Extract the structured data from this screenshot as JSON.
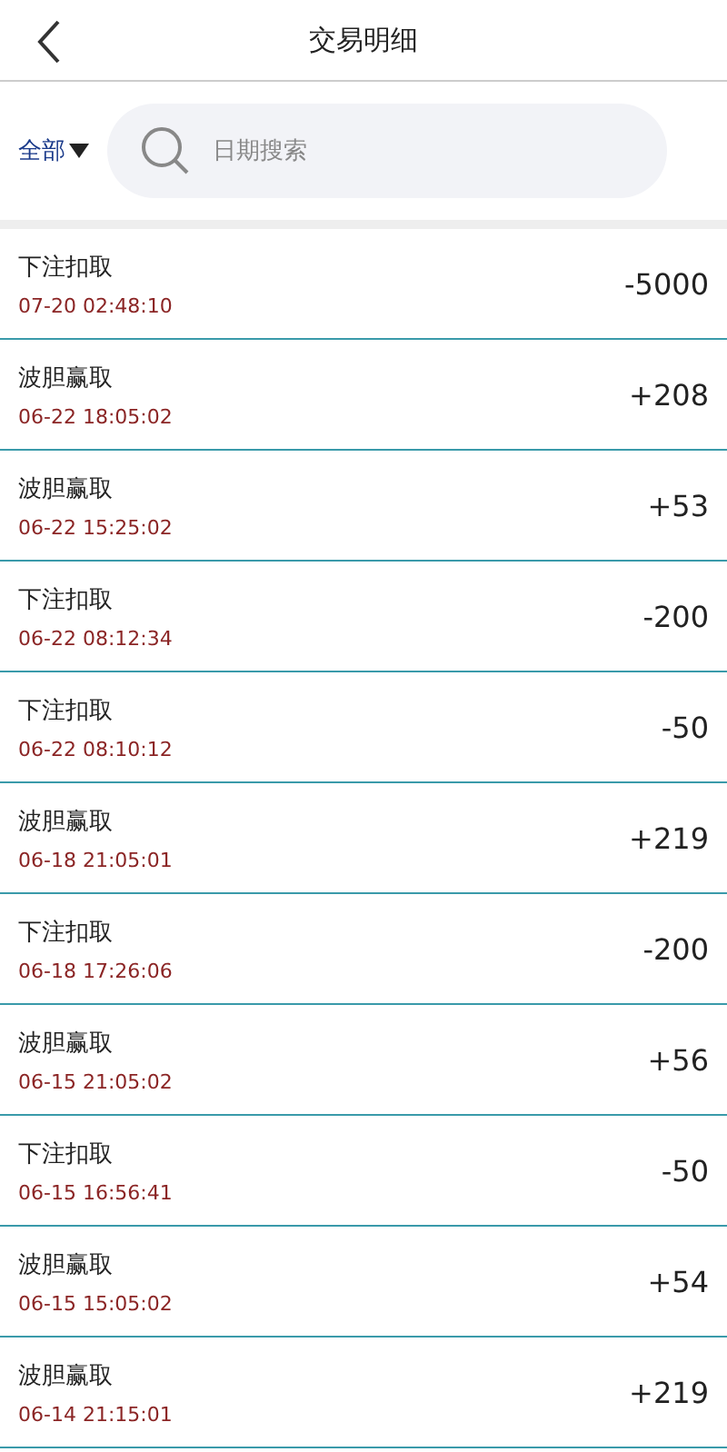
{
  "header": {
    "title": "交易明细"
  },
  "filter": {
    "label": "全部"
  },
  "search": {
    "placeholder": "日期搜索"
  },
  "transactions": [
    {
      "type": "下注扣取",
      "time": "07-20 02:48:10",
      "amount": "-5000"
    },
    {
      "type": "波胆赢取",
      "time": "06-22 18:05:02",
      "amount": "+208"
    },
    {
      "type": "波胆赢取",
      "time": "06-22 15:25:02",
      "amount": "+53"
    },
    {
      "type": "下注扣取",
      "time": "06-22 08:12:34",
      "amount": "-200"
    },
    {
      "type": "下注扣取",
      "time": "06-22 08:10:12",
      "amount": "-50"
    },
    {
      "type": "波胆赢取",
      "time": "06-18 21:05:01",
      "amount": "+219"
    },
    {
      "type": "下注扣取",
      "time": "06-18 17:26:06",
      "amount": "-200"
    },
    {
      "type": "波胆赢取",
      "time": "06-15 21:05:02",
      "amount": "+56"
    },
    {
      "type": "下注扣取",
      "time": "06-15 16:56:41",
      "amount": "-50"
    },
    {
      "type": "波胆赢取",
      "time": "06-15 15:05:02",
      "amount": "+54"
    },
    {
      "type": "波胆赢取",
      "time": "06-14 21:15:01",
      "amount": "+219"
    }
  ]
}
